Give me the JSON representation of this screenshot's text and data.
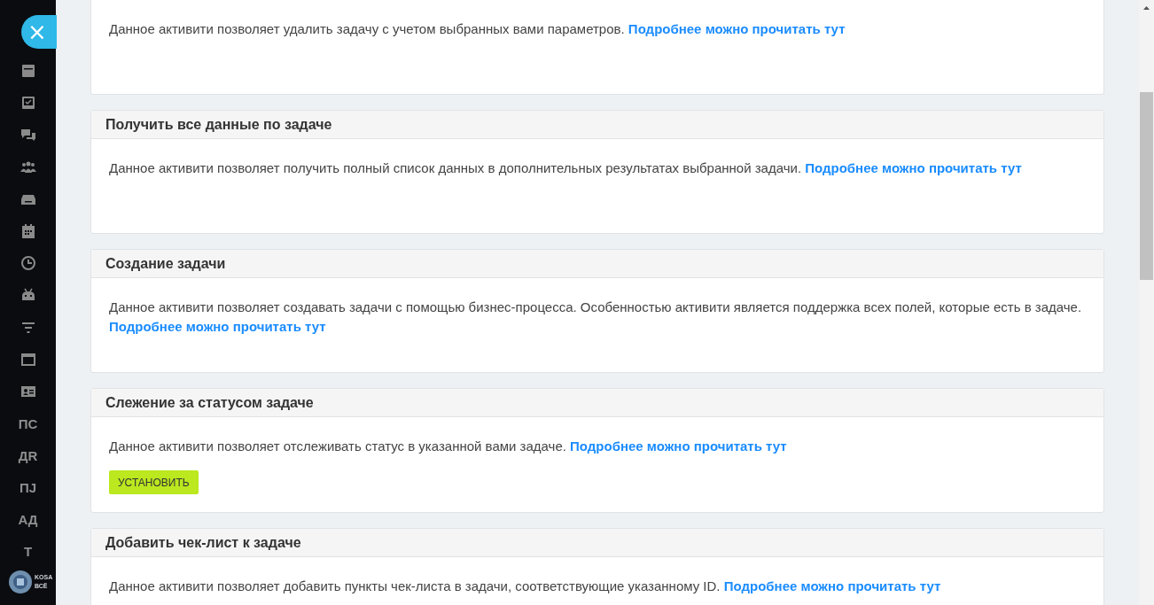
{
  "close_button": {
    "label": "×"
  },
  "sidebar": {
    "items": [
      {
        "kind": "icon"
      },
      {
        "kind": "icon"
      },
      {
        "kind": "icon"
      },
      {
        "kind": "icon"
      },
      {
        "kind": "icon"
      },
      {
        "kind": "icon"
      },
      {
        "kind": "icon"
      },
      {
        "kind": "icon"
      },
      {
        "kind": "icon"
      },
      {
        "kind": "icon"
      },
      {
        "kind": "icon"
      },
      {
        "kind": "text",
        "label": "ПС"
      },
      {
        "kind": "text",
        "label": "ДR"
      },
      {
        "kind": "text",
        "label": "ПJ"
      },
      {
        "kind": "text",
        "label": "АД"
      },
      {
        "kind": "text",
        "label": "Т"
      }
    ],
    "logo": {
      "line_1": "KOSA",
      "line_2": "ВСЁ"
    }
  },
  "cards": [
    {
      "text": "Данное активити позволяет удалить задачу с учетом выбранных вами параметров.",
      "link": "Подробнее можно прочитать тут"
    },
    {
      "title": "Получить все данные по задаче",
      "text": "Данное активити позволяет получить полный список данных в дополнительных результатах выбранной задачи.",
      "link": "Подробнее можно прочитать тут"
    },
    {
      "title": "Создание задачи",
      "text": "Данное активити позволяет создавать задачи с помощью бизнес-процесса. Особенностью активити является поддержка всех полей, которые есть в задаче.",
      "link": "Подробнее можно прочитать тут"
    },
    {
      "title": "Слежение за статусом задаче",
      "text": "Данное активити позволяет отслеживать статус в указанной вами задаче.",
      "link": "Подробнее можно прочитать тут",
      "button": "УСТАНОВИТЬ"
    },
    {
      "title": "Добавить чек-лист к задаче",
      "text": "Данное активити позволяет добавить пункты чек-листа в задачи, соответствующие указанному ID.",
      "link": "Подробнее можно прочитать тут"
    }
  ]
}
